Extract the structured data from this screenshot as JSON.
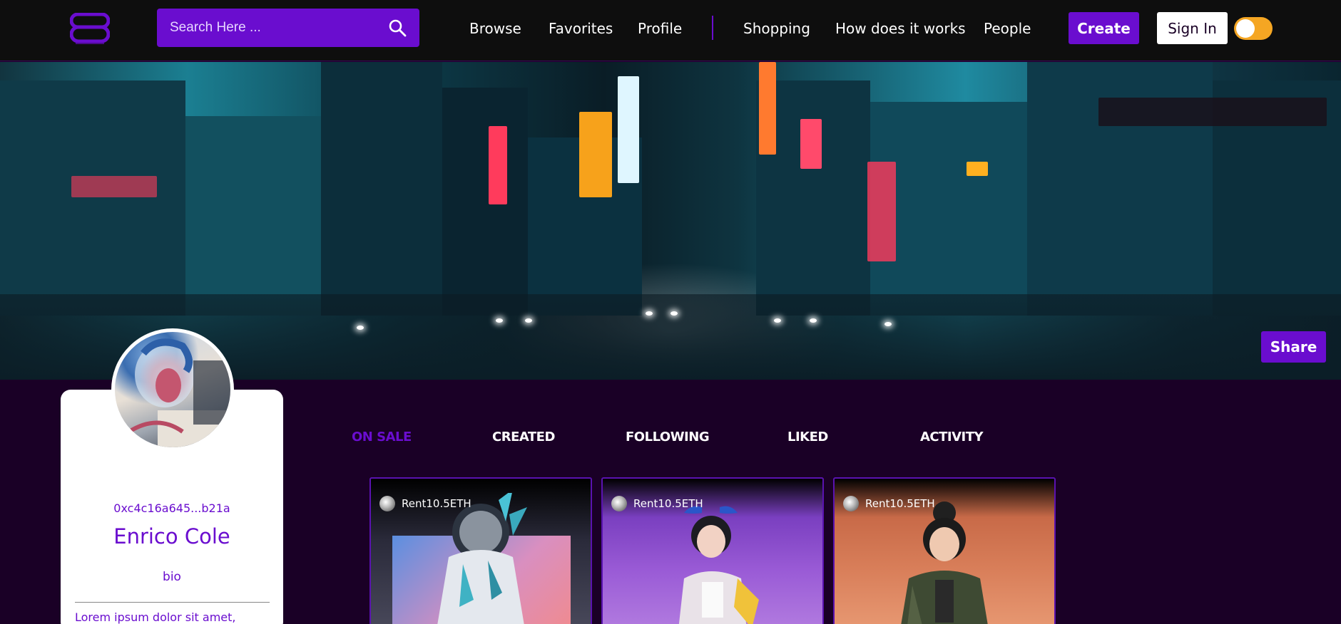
{
  "header": {
    "logo_alt": "SB",
    "search": {
      "placeholder": "Search Here ..."
    },
    "nav_primary": [
      {
        "label": "Browse"
      },
      {
        "label": "Favorites"
      },
      {
        "label": "Profile"
      }
    ],
    "nav_secondary": [
      {
        "label": "Shopping"
      },
      {
        "label": "How does it works"
      },
      {
        "label": "People"
      }
    ],
    "create_label": "Create",
    "signin_label": "Sign In",
    "theme_toggle": {
      "on": false,
      "accent": "#f5a623"
    }
  },
  "banner": {
    "share_label": "Share"
  },
  "profile": {
    "wallet": "0xc4c16a645...b21a",
    "name": "Enrico Cole",
    "bio_label": "bio",
    "bio_text": "Lorem ipsum dolor sit amet,"
  },
  "tabs": [
    {
      "label": "ON SALE",
      "active": true
    },
    {
      "label": "CREATED",
      "active": false
    },
    {
      "label": "FOLLOWING",
      "active": false
    },
    {
      "label": "LIKED",
      "active": false
    },
    {
      "label": "ACTIVITY",
      "active": false
    }
  ],
  "nft_cards": [
    {
      "price": "Rent10.5ETH",
      "art": "astronaut-with-crystals"
    },
    {
      "price": "Rent10.5ETH",
      "art": "anime-girl-purple"
    },
    {
      "price": "Rent10.5ETH",
      "art": "anime-girl-orange"
    }
  ],
  "colors": {
    "accent": "#6a0dcf",
    "page_bg": "#1a0026",
    "header_bg": "#0e0e0e"
  }
}
